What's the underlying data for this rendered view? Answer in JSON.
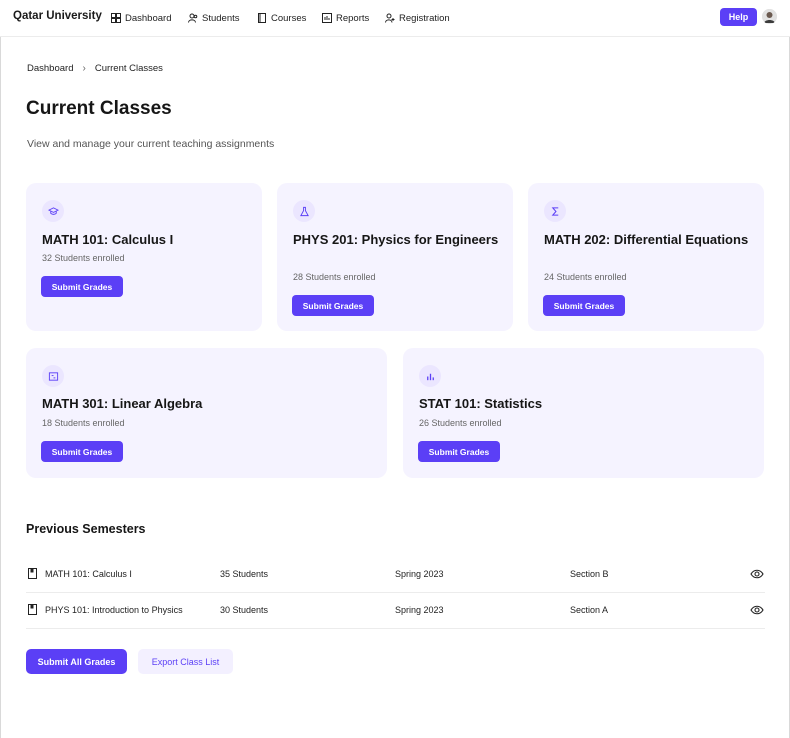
{
  "nav": {
    "brand": "Qatar University",
    "items": [
      {
        "label": "Dashboard",
        "icon": "dashboard-icon"
      },
      {
        "label": "Students",
        "icon": "users-icon"
      },
      {
        "label": "Courses",
        "icon": "book-icon"
      },
      {
        "label": "Reports",
        "icon": "chart-icon"
      },
      {
        "label": "Registration",
        "icon": "user-plus-icon"
      }
    ],
    "help_label": "Help"
  },
  "breadcrumb": {
    "home": "Dashboard",
    "separator": "›",
    "current": "Current Classes"
  },
  "page": {
    "title": "Current Classes",
    "subtitle": "View and manage your current teaching assignments"
  },
  "classes": [
    {
      "title": "MATH 101: Calculus I",
      "enrolled": "32 Students enrolled",
      "button": "Submit Grades",
      "icon": "graduation-cap-icon"
    },
    {
      "title": "PHYS 201: Physics for Engineers",
      "enrolled": "28 Students enrolled",
      "button": "Submit Grades",
      "icon": "flask-icon"
    },
    {
      "title": "MATH 202: Differential Equations",
      "enrolled": "24 Students enrolled",
      "button": "Submit Grades",
      "icon": "sigma-icon"
    },
    {
      "title": "MATH 301: Linear Algebra",
      "enrolled": "18 Students enrolled",
      "button": "Submit Grades",
      "icon": "matrix-icon"
    },
    {
      "title": "STAT 101: Statistics",
      "enrolled": "26 Students enrolled",
      "button": "Submit Grades",
      "icon": "bar-chart-icon"
    }
  ],
  "previous": {
    "title": "Previous Semesters",
    "rows": [
      {
        "course": "MATH 101: Calculus I",
        "students": "35 Students",
        "semester": "Spring 2023",
        "section": "Section B"
      },
      {
        "course": "PHYS 101: Introduction to Physics",
        "students": "30 Students",
        "semester": "Spring 2023",
        "section": "Section A"
      }
    ]
  },
  "actions": {
    "submit_all": "Submit All Grades",
    "export": "Export Class List"
  },
  "colors": {
    "accent": "#5b3ff6",
    "card_bg": "#f5f3ff",
    "icon_bg": "#ebe6ff"
  }
}
